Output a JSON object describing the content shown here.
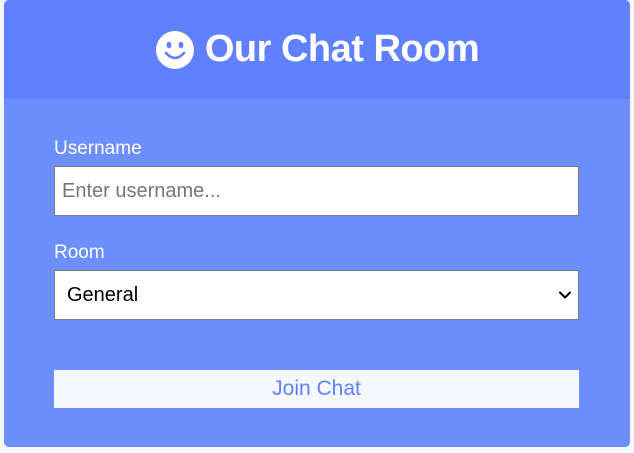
{
  "header": {
    "icon": "smiley-face-icon",
    "title": "Our Chat Room"
  },
  "form": {
    "username": {
      "label": "Username",
      "value": "",
      "placeholder": "Enter username..."
    },
    "room": {
      "label": "Room",
      "selected": "General"
    },
    "submit_label": "Join Chat"
  },
  "colors": {
    "header_bg": "#5f81ff",
    "card_bg": "#6d8ffe",
    "button_bg": "#f5f8fd",
    "button_text": "#5f81ff"
  }
}
